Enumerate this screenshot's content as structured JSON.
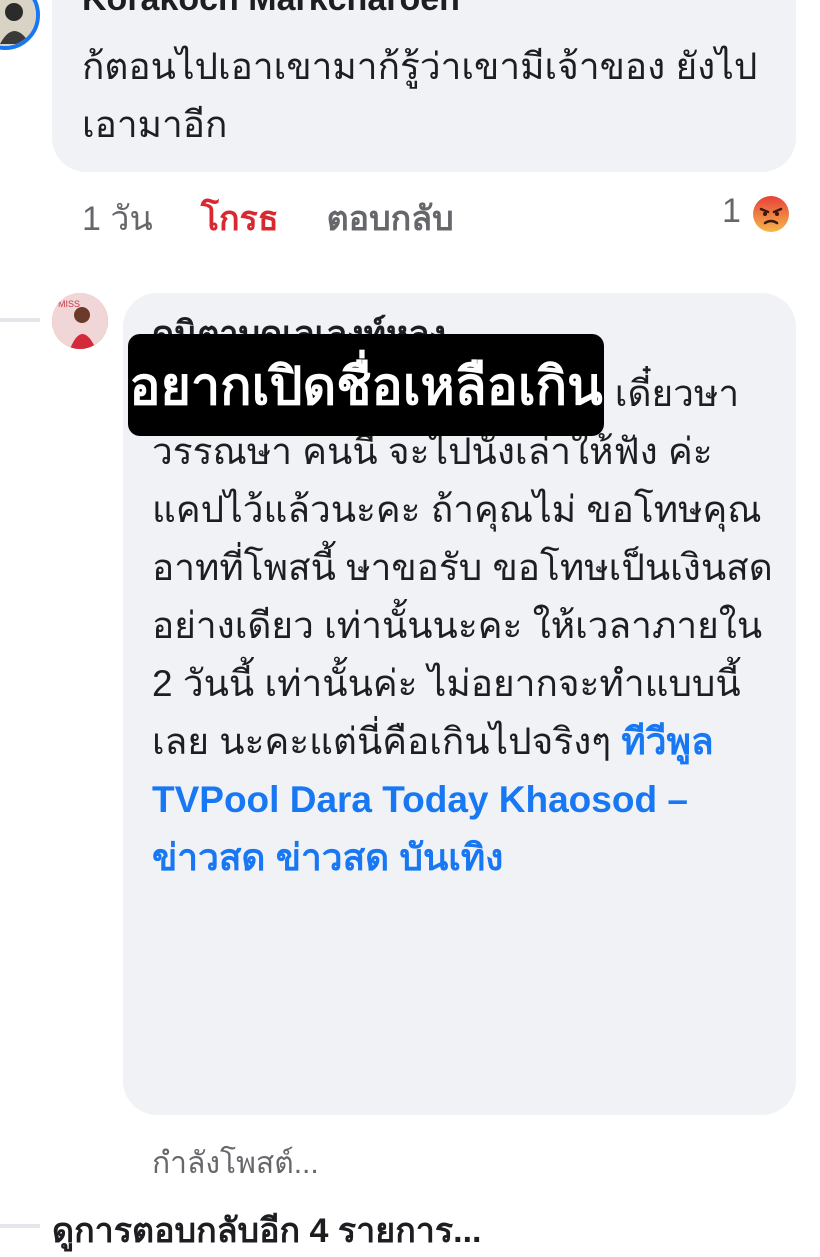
{
  "comment1": {
    "author": "Korakoch Markcharoen",
    "text": "ก้ตอนไปเอาเขามาก้รู้ว่าเขามีเจ้าของ ยังไปเอามาอีก",
    "time": "1 วัน",
    "reaction_label": "โกรธ",
    "reply_label": "ตอบกลับ",
    "reaction_count": "1",
    "reaction_icon": "angry-face-icon"
  },
  "comment2": {
    "author": "ดนิตาบดเลเลงท์หลุง",
    "text": "ก๊อกๆ ๆๆๆ บ้านคุณอยู่ไหนค่ะ เดี๋ยวษา วรรณษา คนนี้ จะไปนั่งเล่าให้ฟัง ค่ะ แคปไว้แล้วนะคะ ถ้าคุณไม่ ขอโทษคุณอาทที่โพสนี้ ษาขอรับ ขอโทษเป็นเงินสดอย่างเดียว เท่านั้นนะคะ ให้เวลาภายใน 2 วันนี้ เท่านั้นค่ะ ไม่อยากจะทำแบบนี้เลย นะคะแต่นี่คือเกินไปจริงๆ",
    "link_text": "ทีวีพูล TVPool Dara Today Khaosod – ข่าวสด ข่าวสด บันเทิง",
    "posting_status": "กำลังโพสต์..."
  },
  "overlay_caption": "อยากเปิดชื่อเหลือเกิน",
  "view_more_replies": "ดูการตอบกลับอีก 4 รายการ...",
  "colors": {
    "bubble": "#f0f2f5",
    "link": "#1877f2",
    "angry": "#d9282f"
  }
}
